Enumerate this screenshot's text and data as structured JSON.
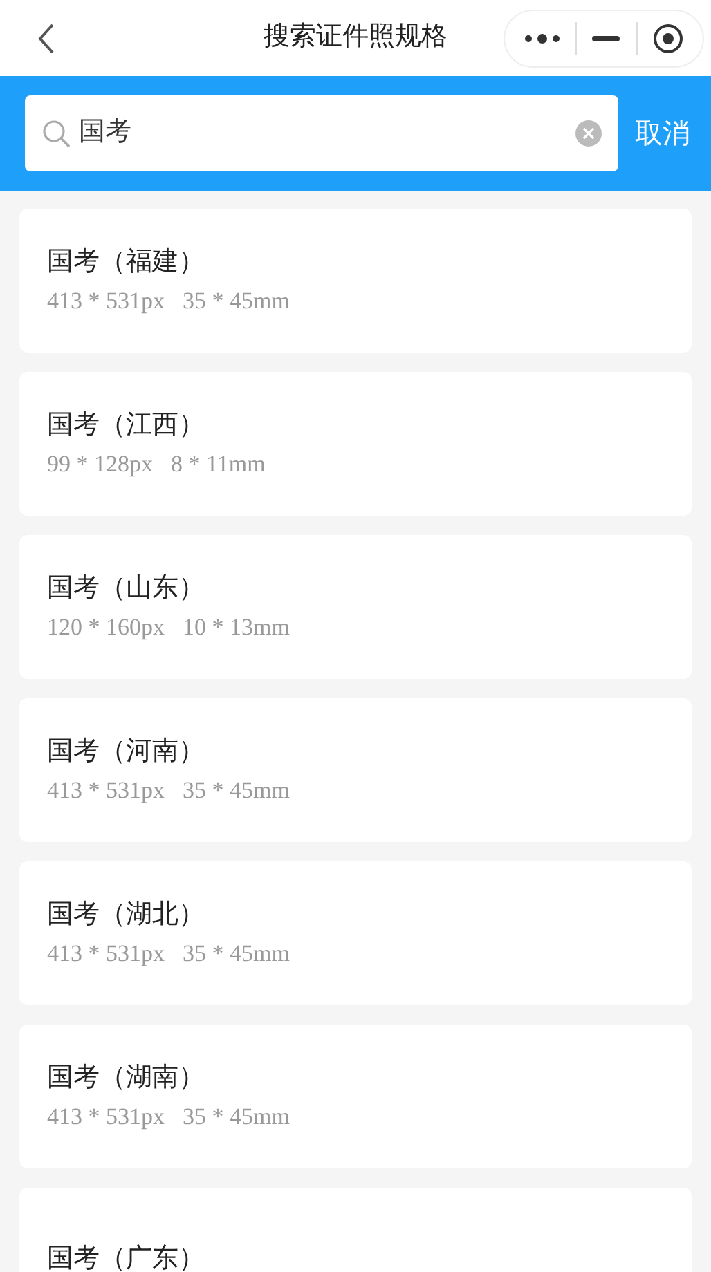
{
  "nav": {
    "title": "搜索证件照规格"
  },
  "search": {
    "value": "国考",
    "cancel": "取消"
  },
  "results": [
    {
      "name": "国考（福建）",
      "pixels": "413 * 531px",
      "size": "35 * 45mm"
    },
    {
      "name": "国考（江西）",
      "pixels": "99 * 128px",
      "size": "8 * 11mm"
    },
    {
      "name": "国考（山东）",
      "pixels": "120 * 160px",
      "size": "10 * 13mm"
    },
    {
      "name": "国考（河南）",
      "pixels": "413 * 531px",
      "size": "35 * 45mm"
    },
    {
      "name": "国考（湖北）",
      "pixels": "413 * 531px",
      "size": "35 * 45mm"
    },
    {
      "name": "国考（湖南）",
      "pixels": "413 * 531px",
      "size": "35 * 45mm"
    },
    {
      "name": "国考（广东）"
    }
  ]
}
